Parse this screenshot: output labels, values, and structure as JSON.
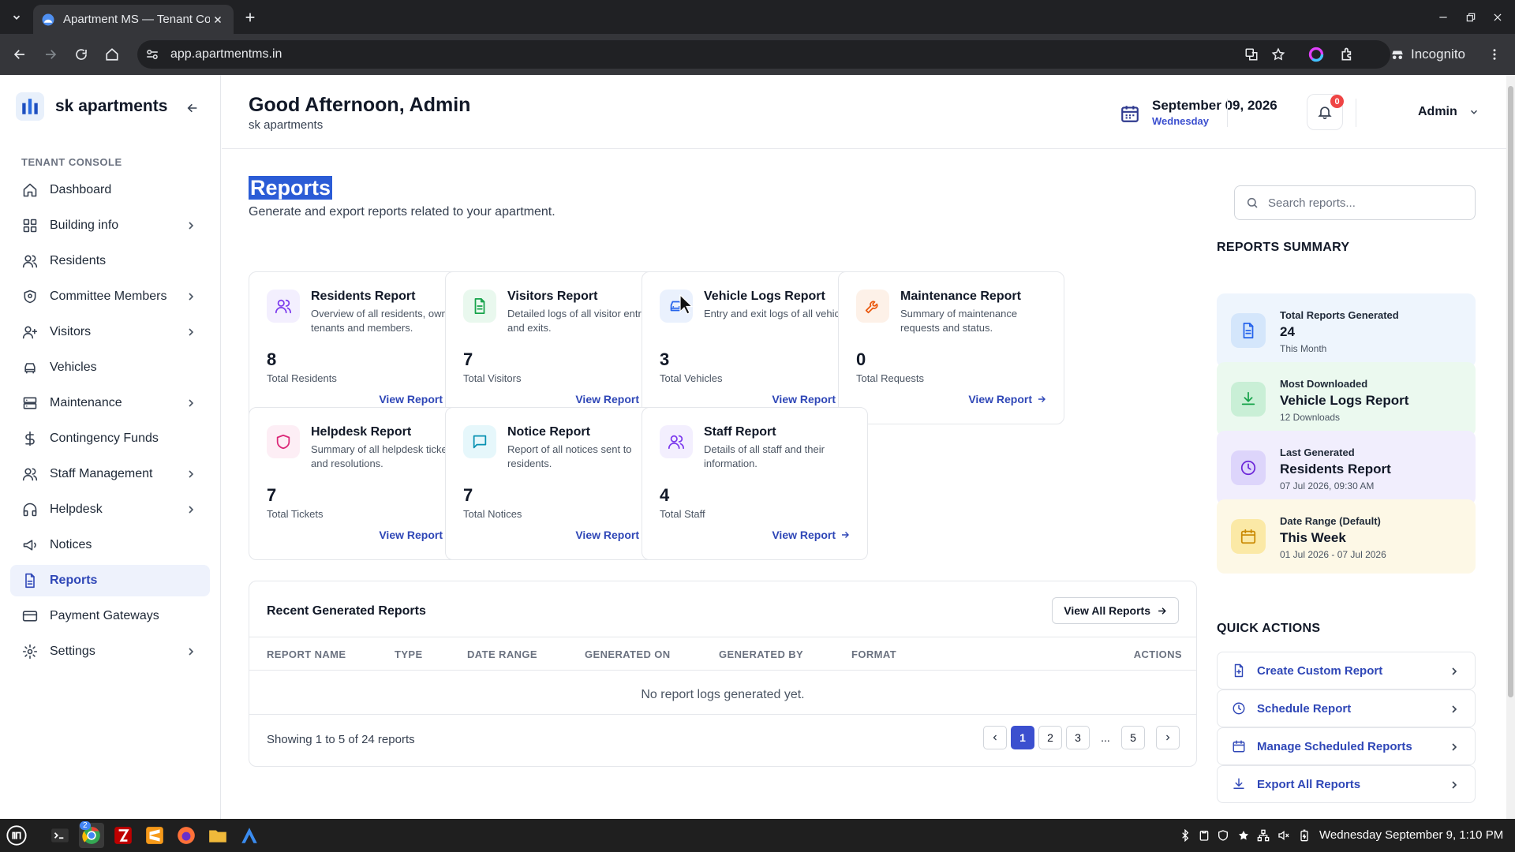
{
  "browser": {
    "tab_title": "Apartment MS — Tenant Console",
    "url": "app.apartmentms.in",
    "profile": "Incognito"
  },
  "sidebar": {
    "brand": "sk apartments",
    "section_label": "TENANT CONSOLE",
    "items": [
      {
        "label": "Dashboard",
        "icon": "home-icon",
        "has_children": false
      },
      {
        "label": "Building info",
        "icon": "grid-icon",
        "has_children": true
      },
      {
        "label": "Residents",
        "icon": "users-icon",
        "has_children": false
      },
      {
        "label": "Committee Members",
        "icon": "shield-icon",
        "has_children": true
      },
      {
        "label": "Visitors",
        "icon": "user-plus-icon",
        "has_children": true
      },
      {
        "label": "Vehicles",
        "icon": "car-icon",
        "has_children": false
      },
      {
        "label": "Maintenance",
        "icon": "server-icon",
        "has_children": true
      },
      {
        "label": "Contingency Funds",
        "icon": "dollar-icon",
        "has_children": false
      },
      {
        "label": "Staff Management",
        "icon": "users-icon",
        "has_children": true
      },
      {
        "label": "Helpdesk",
        "icon": "headphones-icon",
        "has_children": true
      },
      {
        "label": "Notices",
        "icon": "megaphone-icon",
        "has_children": false
      },
      {
        "label": "Reports",
        "icon": "file-icon",
        "has_children": false,
        "active": true
      },
      {
        "label": "Payment Gateways",
        "icon": "credit-card-icon",
        "has_children": false
      },
      {
        "label": "Settings",
        "icon": "gear-icon",
        "has_children": true
      }
    ]
  },
  "header": {
    "greeting": "Good Afternoon, Admin",
    "subtitle": "sk apartments",
    "date": "September 09, 2026",
    "weekday": "Wednesday",
    "notification_count": "0",
    "user": "Admin"
  },
  "page": {
    "title": "Reports",
    "subtitle": "Generate and export reports related to your apartment.",
    "search_placeholder": "Search reports..."
  },
  "reports": [
    {
      "title": "Residents Report",
      "desc": "Overview of all residents, owners, tenants and members.",
      "count": "8",
      "count_label": "Total Residents",
      "link": "View Report",
      "color": "#7c3aed",
      "bg": "#f3effe"
    },
    {
      "title": "Visitors Report",
      "desc": "Detailed logs of all visitor entries and exits.",
      "count": "7",
      "count_label": "Total Visitors",
      "link": "View Report",
      "color": "#16a34a",
      "bg": "#e9f8ee"
    },
    {
      "title": "Vehicle Logs Report",
      "desc": "Entry and exit logs of all vehicles.",
      "count": "3",
      "count_label": "Total Vehicles",
      "link": "View Report",
      "color": "#2563eb",
      "bg": "#eaf1fd"
    },
    {
      "title": "Maintenance Report",
      "desc": "Summary of maintenance requests and status.",
      "count": "0",
      "count_label": "Total Requests",
      "link": "View Report",
      "color": "#ea580c",
      "bg": "#fdf1e8"
    },
    {
      "title": "Helpdesk Report",
      "desc": "Summary of all helpdesk tickets and resolutions.",
      "count": "7",
      "count_label": "Total Tickets",
      "link": "View Report",
      "color": "#db2777",
      "bg": "#fdeef5"
    },
    {
      "title": "Notice Report",
      "desc": "Report of all notices sent to residents.",
      "count": "7",
      "count_label": "Total Notices",
      "link": "View Report",
      "color": "#0891b2",
      "bg": "#e6f7fb"
    },
    {
      "title": "Staff Report",
      "desc": "Details of all staff and their information.",
      "count": "4",
      "count_label": "Total Staff",
      "link": "View Report",
      "color": "#7c3aed",
      "bg": "#f3effe"
    }
  ],
  "recent": {
    "title": "Recent Generated Reports",
    "view_all": "View All Reports",
    "columns": [
      "REPORT NAME",
      "TYPE",
      "DATE RANGE",
      "GENERATED ON",
      "GENERATED BY",
      "FORMAT",
      "ACTIONS"
    ],
    "empty": "No report logs generated yet.",
    "showing": "Showing 1 to 5 of 24 reports",
    "pages": [
      "1",
      "2",
      "3",
      "...",
      "5"
    ]
  },
  "summary": {
    "title": "REPORTS SUMMARY",
    "cards": [
      {
        "label": "Total Reports Generated",
        "value": "24",
        "sub": "This Month",
        "color": "#2563eb",
        "bg": "#eef5fd",
        "icon_bg": "#d4e6fb"
      },
      {
        "label": "Most Downloaded",
        "value": "Vehicle Logs Report",
        "sub": "12 Downloads",
        "color": "#16a34a",
        "bg": "#ebf9ef",
        "icon_bg": "#c9efd6"
      },
      {
        "label": "Last Generated",
        "value": "Residents Report",
        "sub": "07 Jul 2026, 09:30 AM",
        "color": "#6d28d9",
        "bg": "#f1eefd",
        "icon_bg": "#ddd5fb"
      },
      {
        "label": "Date Range (Default)",
        "value": "This Week",
        "sub": "01 Jul 2026 - 07 Jul 2026",
        "color": "#ca8a04",
        "bg": "#fdf8e6",
        "icon_bg": "#fbe9a6"
      }
    ]
  },
  "quick_actions": {
    "title": "QUICK ACTIONS",
    "items": [
      "Create Custom Report",
      "Schedule Report",
      "Manage Scheduled Reports",
      "Export All Reports"
    ]
  },
  "taskbar": {
    "clock": "Wednesday September 9, 1:10 PM",
    "chrome_badge": "2"
  }
}
